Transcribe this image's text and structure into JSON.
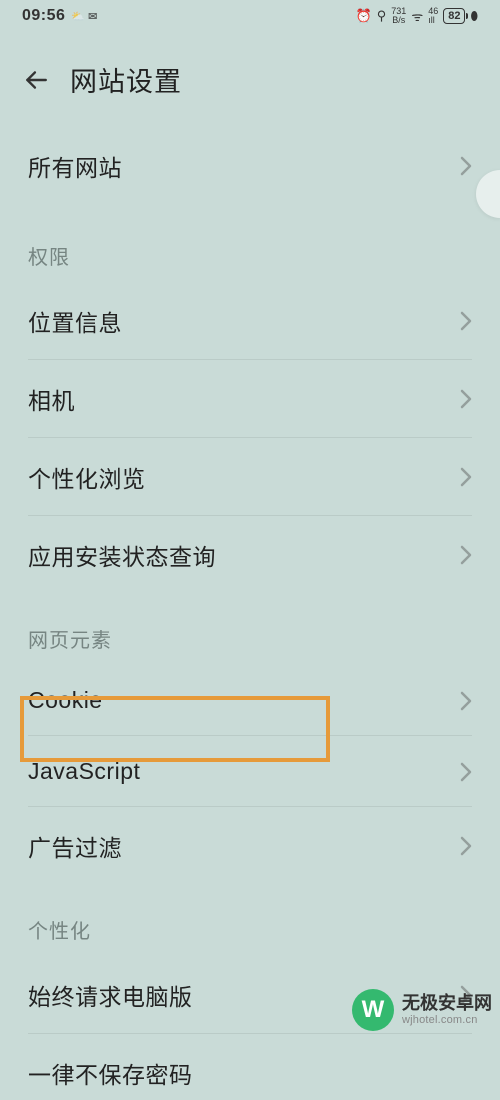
{
  "status": {
    "time": "09:56",
    "alarm": "⏰",
    "bt": "⚲",
    "speed_top": "731",
    "speed_bottom": "B/s",
    "wifi": "ᯤ",
    "net_top": "46",
    "net_bottom": "ıll",
    "battery": "82",
    "leaf": "⬮"
  },
  "header": {
    "title": "网站设置"
  },
  "top": {
    "all_sites": "所有网站"
  },
  "sections": {
    "permissions": {
      "title": "权限",
      "items": {
        "location": "位置信息",
        "camera": "相机",
        "personalized_browsing": "个性化浏览",
        "app_install_query": "应用安装状态查询"
      }
    },
    "page_elements": {
      "title": "网页元素",
      "items": {
        "cookie": "Cookie",
        "javascript": "JavaScript",
        "ad_filter": "广告过滤"
      }
    },
    "personalization": {
      "title": "个性化",
      "items": {
        "desktop_mode": "始终请求电脑版",
        "never_save_pw": "一律不保存密码"
      }
    }
  },
  "watermark": {
    "brand": "无极安卓网",
    "url": "wjhotel.com.cn",
    "logo": "W"
  }
}
